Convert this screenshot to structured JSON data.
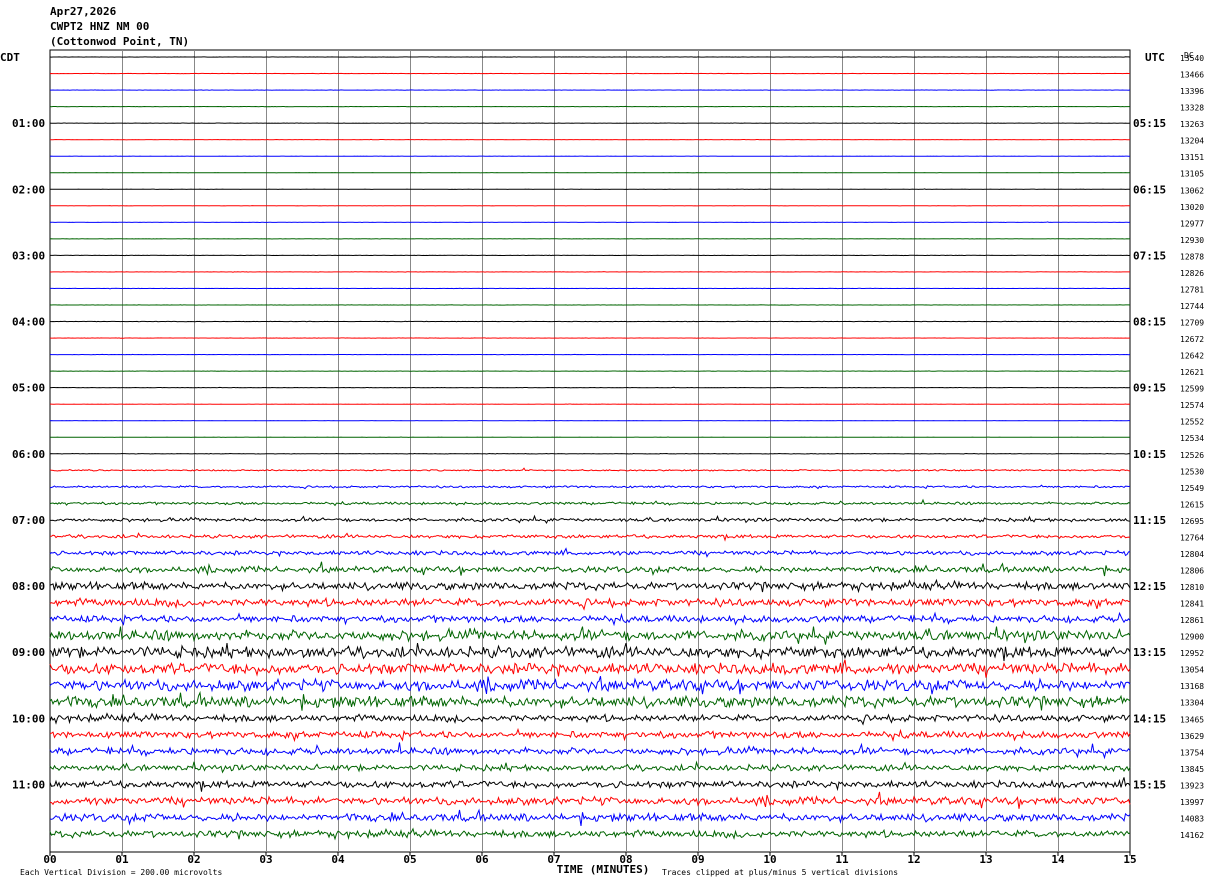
{
  "header": {
    "date": "Apr27,2026",
    "station": "CWPT2 HNZ NM 00",
    "location": "(Cottonwod Point, TN)"
  },
  "chart_data": {
    "type": "line",
    "title": "",
    "xlabel": "TIME (MINUTES)",
    "x_ticks": [
      "00",
      "01",
      "02",
      "03",
      "04",
      "05",
      "06",
      "07",
      "08",
      "09",
      "10",
      "11",
      "12",
      "13",
      "14",
      "15"
    ],
    "xlim": [
      0,
      15
    ],
    "left_axis_label": "CDT",
    "right_axis_label": "UTC",
    "dc_label": "DC",
    "left_time_labels": [
      "01:00",
      "02:00",
      "03:00",
      "04:00",
      "05:00",
      "06:00",
      "07:00",
      "08:00",
      "09:00",
      "10:00",
      "11:00"
    ],
    "right_time_labels": [
      "05:15",
      "06:15",
      "07:15",
      "08:15",
      "09:15",
      "10:15",
      "11:15",
      "12:15",
      "13:15",
      "14:15",
      "15:15"
    ],
    "dc_offsets": [
      13540,
      13466,
      13396,
      13328,
      13263,
      13204,
      13151,
      13105,
      13062,
      13020,
      12977,
      12930,
      12878,
      12826,
      12781,
      12744,
      12709,
      12672,
      12642,
      12621,
      12599,
      12574,
      12552,
      12534,
      12526,
      12530,
      12549,
      12615,
      12695,
      12764,
      12804,
      12806,
      12810,
      12841,
      12861,
      12900,
      12952,
      13054,
      13168,
      13304,
      13465,
      13629,
      13754,
      13845,
      13923,
      13997,
      14083,
      14162
    ],
    "trace_colors": [
      "#000000",
      "#ff0000",
      "#0000ff",
      "#006400"
    ],
    "trace_activity": [
      0.15,
      0.15,
      0.15,
      0.15,
      0.15,
      0.15,
      0.15,
      0.15,
      0.18,
      0.15,
      0.15,
      0.15,
      0.18,
      0.15,
      0.15,
      0.15,
      0.2,
      0.15,
      0.15,
      0.15,
      0.2,
      0.15,
      0.15,
      0.15,
      0.3,
      0.8,
      1.2,
      1.5,
      2.0,
      2.0,
      2.5,
      3.5,
      4.5,
      4.5,
      4.0,
      6.0,
      6.5,
      6.5,
      6.5,
      6.5,
      4.0,
      4.0,
      4.0,
      3.5,
      4.0,
      4.5,
      4.5,
      4.0
    ],
    "footer_left": "Each Vertical Division =  200.00 microvolts",
    "footer_right": "Traces clipped at plus/minus 5 vertical divisions"
  }
}
